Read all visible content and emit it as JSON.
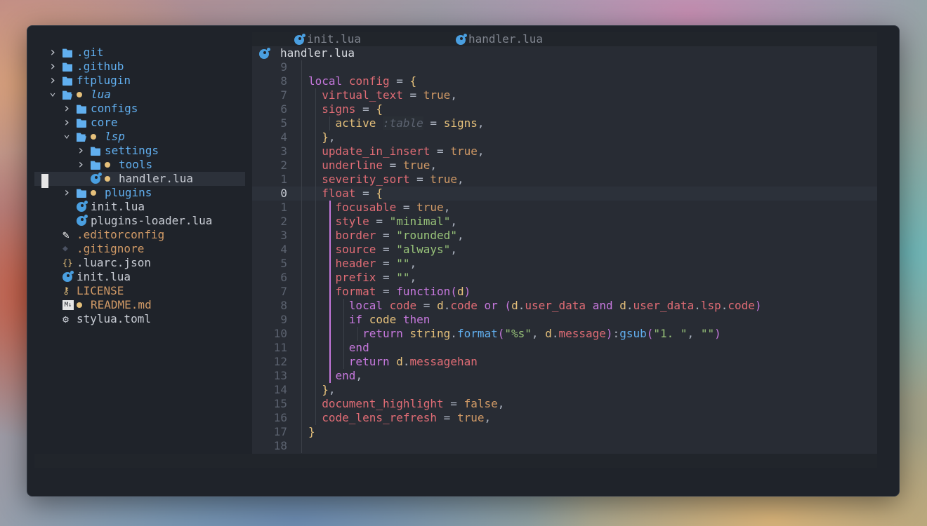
{
  "tabs": [
    {
      "label": "init.lua",
      "icon": "lua-icon"
    },
    {
      "label": "handler.lua",
      "icon": "lua-icon"
    }
  ],
  "editor_filename": "handler.lua",
  "tree": [
    {
      "label": ".git",
      "type": "folder",
      "open": false
    },
    {
      "label": ".github",
      "type": "folder",
      "open": false
    },
    {
      "label": "ftplugin",
      "type": "folder",
      "open": false
    },
    {
      "label": "lua",
      "type": "folder",
      "open": true,
      "modified": true
    },
    {
      "label": "configs",
      "type": "folder",
      "open": false
    },
    {
      "label": "core",
      "type": "folder",
      "open": false
    },
    {
      "label": "lsp",
      "type": "folder",
      "open": true,
      "modified": true
    },
    {
      "label": "settings",
      "type": "folder",
      "open": false
    },
    {
      "label": "tools",
      "type": "folder",
      "open": false,
      "modified": true
    },
    {
      "label": "handler.lua",
      "type": "lua",
      "modified": true,
      "selected": true
    },
    {
      "label": "plugins",
      "type": "folder",
      "open": false,
      "modified": true
    },
    {
      "label": "init.lua",
      "type": "lua"
    },
    {
      "label": "plugins-loader.lua",
      "type": "lua"
    },
    {
      "label": ".editorconfig",
      "type": "editorconfig"
    },
    {
      "label": ".gitignore",
      "type": "git"
    },
    {
      "label": ".luarc.json",
      "type": "json"
    },
    {
      "label": "init.lua",
      "type": "lua"
    },
    {
      "label": "LICENSE",
      "type": "license"
    },
    {
      "label": "README.md",
      "type": "markdown",
      "modified": true
    },
    {
      "label": "stylua.toml",
      "type": "config"
    }
  ],
  "line_numbers": [
    "9",
    "8",
    "7",
    "6",
    "5",
    "4",
    "3",
    "2",
    "1",
    "0",
    "1",
    "2",
    "3",
    "4",
    "5",
    "6",
    "7",
    "8",
    "9",
    "10",
    "11",
    "12",
    "13",
    "14",
    "15",
    "16",
    "17",
    "18"
  ],
  "code_lines": [
    "",
    "local config = {",
    "  virtual_text = true,",
    "  signs = {",
    "    active :table = signs,",
    "  },",
    "  update_in_insert = true,",
    "  underline = true,",
    "  severity_sort = true,",
    "  float = {",
    "    focusable = true,",
    "    style = \"minimal\",",
    "    border = \"rounded\",",
    "    source = \"always\",",
    "    header = \"\",",
    "    prefix = \"\",",
    "    format = function(d)",
    "      local code = d.code or (d.user_data and d.user_data.lsp.code)",
    "      if code then",
    "        return string.format(\"%s\", d.message):gsub(\"1. \", \"\")",
    "      end",
    "      return d.messagehan",
    "    end,",
    "  },",
    "  document_highlight = false,",
    "  code_lens_refresh = true,",
    "}",
    ""
  ],
  "colors": {
    "keyword": "#c678dd",
    "field": "#e06c75",
    "boolean": "#d19a66",
    "string": "#98c379",
    "function": "#61afef",
    "bracket": "#e5c07b",
    "folder": "#61afef",
    "modified": "#e5c07b"
  }
}
